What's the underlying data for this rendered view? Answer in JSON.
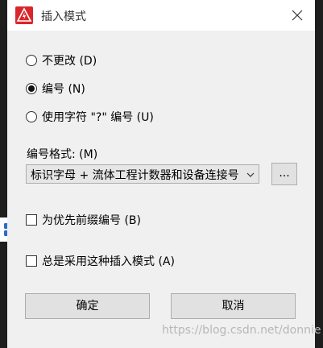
{
  "window": {
    "title": "插入模式",
    "close_icon": "close-icon",
    "app_icon": "warning-lightning-icon"
  },
  "radios": [
    {
      "label": "不更改 (D)",
      "checked": false
    },
    {
      "label": "编号 (N)",
      "checked": true
    },
    {
      "label": "使用字符 \"?\" 编号 (U)",
      "checked": false
    }
  ],
  "format": {
    "label": "编号格式: (M)",
    "value": "标识字母 + 流体工程计数器和设备连接号",
    "browse_label": "..."
  },
  "checkboxes": [
    {
      "label": "为优先前缀编号 (B)",
      "checked": false
    },
    {
      "label": "总是采用这种插入模式 (A)",
      "checked": false
    }
  ],
  "buttons": {
    "ok": "确定",
    "cancel": "取消"
  },
  "watermark": "https://blog.csdn.net/donnie",
  "colors": {
    "dialog_bg": "#f0f0f0",
    "titlebar_bg": "#ffffff",
    "app_icon_bg": "#d9262b",
    "side_widget_icon": "#2b6cc4"
  }
}
